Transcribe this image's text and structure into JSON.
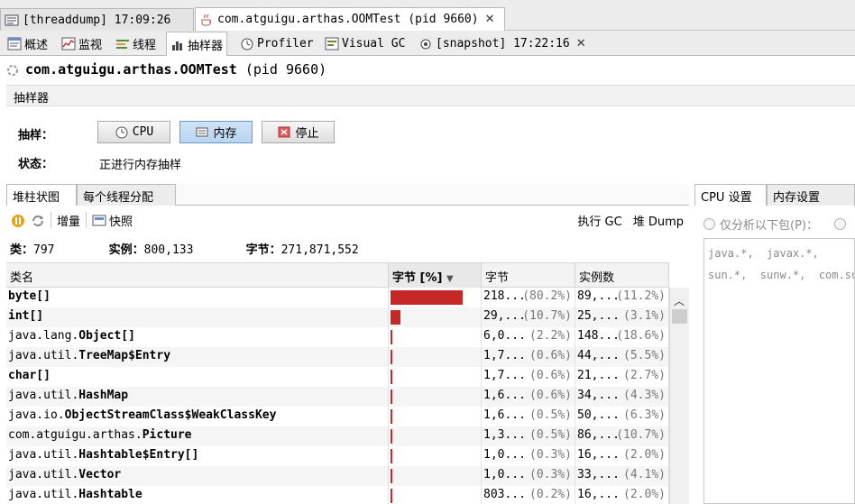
{
  "doc_tabs": [
    {
      "label": "[threaddump] 17:09:26",
      "icon": "threaddump-icon"
    },
    {
      "label": "com.atguigu.arthas.OOMTest (pid 9660)",
      "icon": "java-app-icon"
    }
  ],
  "sub_tabs": [
    {
      "label": "概述",
      "icon": "overview-icon"
    },
    {
      "label": "监视",
      "icon": "monitor-icon"
    },
    {
      "label": "线程",
      "icon": "threads-icon"
    },
    {
      "label": "抽样器",
      "icon": "sampler-icon"
    },
    {
      "label": "Profiler",
      "icon": "profiler-icon"
    },
    {
      "label": "Visual GC",
      "icon": "visual-gc-icon"
    },
    {
      "label": "[snapshot] 17:22:16",
      "icon": "snapshot-icon"
    }
  ],
  "app_title_main": "com.atguigu.arthas.OOMTest",
  "app_title_pid": "(pid 9660)",
  "section_header": "抽样器",
  "sampler": {
    "sample_label": "抽样：",
    "cpu_button": "CPU",
    "memory_button": "内存",
    "stop_button": "停止",
    "status_label": "状态：",
    "status_value": "正进行内存抽样"
  },
  "view_tabs": [
    "堆柱状图",
    "每个线程分配"
  ],
  "toolbar": {
    "delta_label": "增量",
    "snapshot_label": "快照",
    "gc_label": "执行 GC",
    "heap_dump_label": "堆 Dump"
  },
  "summary": {
    "classes_label": "类：",
    "classes_value": "797",
    "instances_label": "实例：",
    "instances_value": "800,133",
    "bytes_label": "字节：",
    "bytes_value": "271,871,552"
  },
  "table": {
    "headers": [
      "类名",
      "字节 [%]",
      "字节",
      "实例数"
    ],
    "sort_indicator": "▼",
    "rows": [
      {
        "prefix": "",
        "name": "byte[]",
        "bytes_pct": 80.2,
        "bytes": "218...",
        "bytes_pct_text": "(80.2%)",
        "instances": "89,...",
        "inst_pct_text": "(11.2%)"
      },
      {
        "prefix": "",
        "name": "int[]",
        "bytes_pct": 10.7,
        "bytes": "29,...",
        "bytes_pct_text": "(10.7%)",
        "instances": "25,...",
        "inst_pct_text": "(3.1%)"
      },
      {
        "prefix": "java.lang.",
        "name": "Object[]",
        "bytes_pct": 2.2,
        "bytes": "6,0...",
        "bytes_pct_text": "(2.2%)",
        "instances": "148...",
        "inst_pct_text": "(18.6%)"
      },
      {
        "prefix": "java.util.",
        "name": "TreeMap$Entry",
        "bytes_pct": 0.6,
        "bytes": "1,7...",
        "bytes_pct_text": "(0.6%)",
        "instances": "44,...",
        "inst_pct_text": "(5.5%)"
      },
      {
        "prefix": "",
        "name": "char[]",
        "bytes_pct": 0.6,
        "bytes": "1,7...",
        "bytes_pct_text": "(0.6%)",
        "instances": "21,...",
        "inst_pct_text": "(2.7%)"
      },
      {
        "prefix": "java.util.",
        "name": "HashMap",
        "bytes_pct": 0.6,
        "bytes": "1,6...",
        "bytes_pct_text": "(0.6%)",
        "instances": "34,...",
        "inst_pct_text": "(4.3%)"
      },
      {
        "prefix": "java.io.",
        "name": "ObjectStreamClass$WeakClassKey",
        "bytes_pct": 0.5,
        "bytes": "1,6...",
        "bytes_pct_text": "(0.5%)",
        "instances": "50,...",
        "inst_pct_text": "(6.3%)"
      },
      {
        "prefix": "com.atguigu.arthas.",
        "name": "Picture",
        "bytes_pct": 0.5,
        "bytes": "1,3...",
        "bytes_pct_text": "(0.5%)",
        "instances": "86,...",
        "inst_pct_text": "(10.7%)"
      },
      {
        "prefix": "java.util.",
        "name": "Hashtable$Entry[]",
        "bytes_pct": 0.3,
        "bytes": "1,0...",
        "bytes_pct_text": "(0.3%)",
        "instances": "16,...",
        "inst_pct_text": "(2.0%)"
      },
      {
        "prefix": "java.util.",
        "name": "Vector",
        "bytes_pct": 0.3,
        "bytes": "1,0...",
        "bytes_pct_text": "(0.3%)",
        "instances": "33,...",
        "inst_pct_text": "(4.1%)"
      },
      {
        "prefix": "java.util.",
        "name": "Hashtable",
        "bytes_pct": 0.2,
        "bytes": "803...",
        "bytes_pct_text": "(0.2%)",
        "instances": "16,...",
        "inst_pct_text": "(2.0%)"
      }
    ]
  },
  "settings_tabs": [
    "CPU 设置",
    "内存设置"
  ],
  "settings": {
    "radio_label": "仅分析以下包(P)：",
    "packages": "java.*,  javax.*,\nsun.*,  sunw.*,  com.sun"
  },
  "colors": {
    "bar": "#c62828",
    "pressed_button": "#b8d5f2"
  }
}
